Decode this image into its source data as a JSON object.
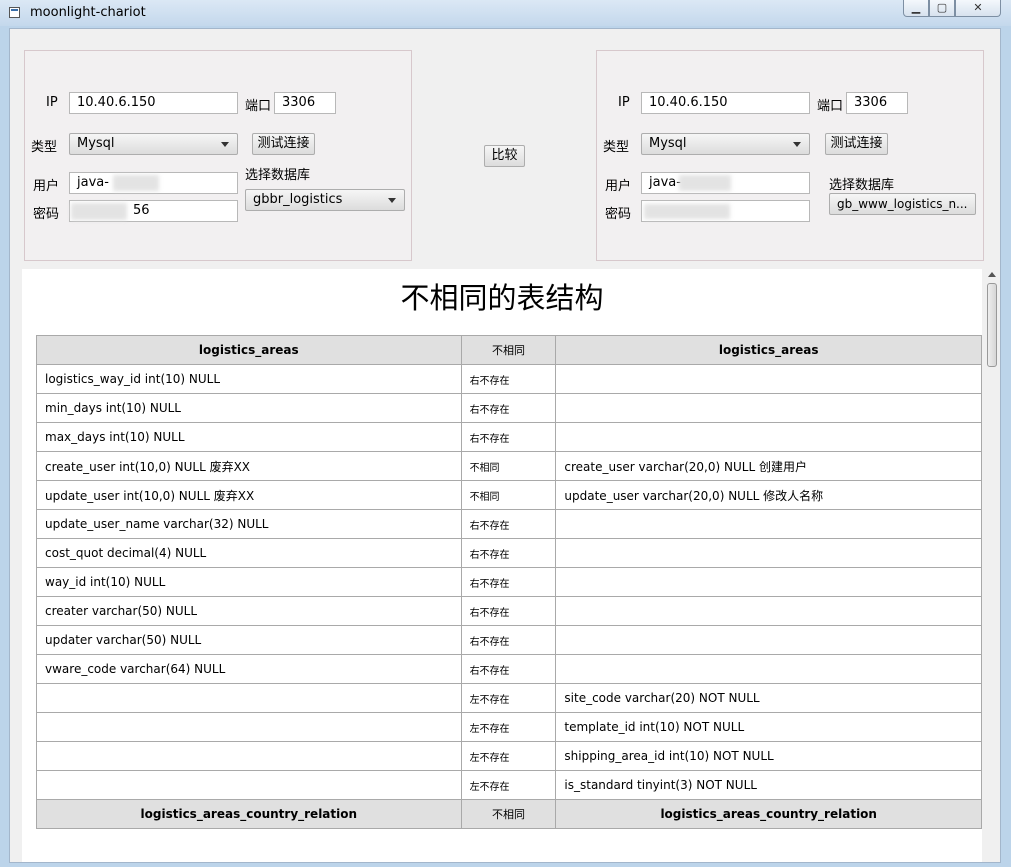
{
  "window": {
    "title": "moonlight-chariot",
    "min_glyph": "▁",
    "max_glyph": "▢",
    "close_glyph": "✕"
  },
  "left": {
    "ip_label": "IP",
    "ip": "10.40.6.150",
    "port_label": "端口",
    "port": "3306",
    "type_label": "类型",
    "type": "Mysql",
    "test_button": "测试连接",
    "db_label": "选择数据库",
    "db": "gbbr_logistics",
    "user_label": "用户",
    "user": "java-",
    "password_label": "密码",
    "password": "56"
  },
  "compare_button": "比较",
  "right": {
    "ip_label": "IP",
    "ip": "10.40.6.150",
    "port_label": "端口",
    "port": "3306",
    "type_label": "类型",
    "type": "Mysql",
    "test_button": "测试连接",
    "db_label": "选择数据库",
    "db": "gb_www_logistics_n...",
    "user_label": "用户",
    "user": "java-",
    "password_label": "密码",
    "password": ""
  },
  "result": {
    "title": "不相同的表结构",
    "tables": [
      {
        "left_name": "logistics_areas",
        "status": "不相同",
        "right_name": "logistics_areas",
        "rows": [
          {
            "left": "logistics_way_id int(10) NULL",
            "status": "右不存在",
            "right": ""
          },
          {
            "left": "min_days int(10) NULL",
            "status": "右不存在",
            "right": ""
          },
          {
            "left": "max_days int(10) NULL",
            "status": "右不存在",
            "right": ""
          },
          {
            "left": "create_user int(10,0) NULL 废弃XX",
            "status": "不相同",
            "right": "create_user varchar(20,0) NULL 创建用户"
          },
          {
            "left": "update_user int(10,0) NULL 废弃XX",
            "status": "不相同",
            "right": "update_user varchar(20,0) NULL 修改人名称"
          },
          {
            "left": "update_user_name varchar(32) NULL",
            "status": "右不存在",
            "right": ""
          },
          {
            "left": "cost_quot decimal(4) NULL",
            "status": "右不存在",
            "right": ""
          },
          {
            "left": "way_id int(10) NULL",
            "status": "右不存在",
            "right": ""
          },
          {
            "left": "creater varchar(50) NULL",
            "status": "右不存在",
            "right": ""
          },
          {
            "left": "updater varchar(50) NULL",
            "status": "右不存在",
            "right": ""
          },
          {
            "left": "vware_code varchar(64) NULL",
            "status": "右不存在",
            "right": ""
          },
          {
            "left": "",
            "status": "左不存在",
            "right": "site_code varchar(20) NOT NULL"
          },
          {
            "left": "",
            "status": "左不存在",
            "right": "template_id int(10) NOT NULL"
          },
          {
            "left": "",
            "status": "左不存在",
            "right": "shipping_area_id int(10) NOT NULL"
          },
          {
            "left": "",
            "status": "左不存在",
            "right": "is_standard tinyint(3) NOT NULL"
          }
        ]
      },
      {
        "left_name": "logistics_areas_country_relation",
        "status": "不相同",
        "right_name": "logistics_areas_country_relation",
        "rows": []
      }
    ]
  }
}
